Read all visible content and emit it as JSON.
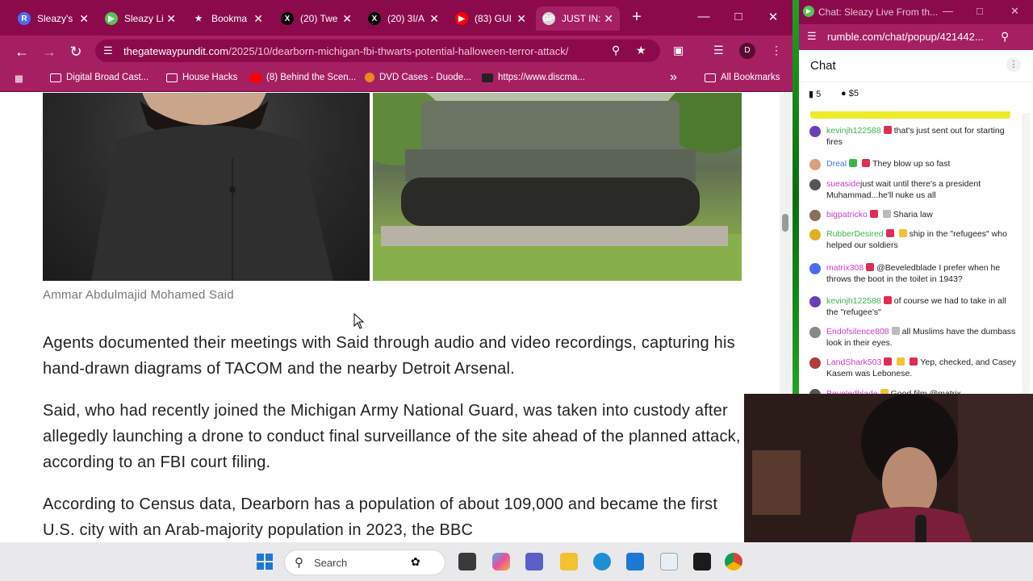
{
  "browser": {
    "tabs": [
      {
        "title": "Sleazy's",
        "icon_letter": "R",
        "icon_color": "#4a6cf7",
        "active": false
      },
      {
        "title": "Sleazy Li",
        "icon_letter": "▶",
        "icon_color": "#53c453",
        "active": false
      },
      {
        "title": "Bookma",
        "icon_letter": "★",
        "icon_color": "#8b0a4b",
        "active": false
      },
      {
        "title": "(20) Twe",
        "icon_letter": "X",
        "icon_color": "#000000",
        "active": false
      },
      {
        "title": "(20) 3I/A",
        "icon_letter": "X",
        "icon_color": "#000000",
        "active": false
      },
      {
        "title": "(83) GUI",
        "icon_letter": "▶",
        "icon_color": "#ff0000",
        "active": false
      },
      {
        "title": "JUST IN:",
        "icon_letter": "GP",
        "icon_color": "#d7d7d7",
        "active": true
      }
    ],
    "new_tab_label": "+",
    "url_domain": "thegatewaypundit.com",
    "url_path": "/2025/10/dearborn-michigan-fbi-thwarts-potential-halloween-terror-attack/",
    "profile_letter": "D",
    "bookmarks": [
      {
        "label": "Digital Broad Cast...",
        "icon": "folder-icon"
      },
      {
        "label": "House Hacks",
        "icon": "folder-icon"
      },
      {
        "label": "(8) Behind the Scen...",
        "icon": "youtube-icon"
      },
      {
        "label": "DVD Cases - Duode...",
        "icon": "dvd-icon"
      },
      {
        "label": "https://www.discma...",
        "icon": "discord-icon"
      }
    ],
    "all_bookmarks_label": "All Bookmarks",
    "overflow_label": "»"
  },
  "article": {
    "caption": "Ammar Abdulmajid Mohamed Said",
    "paragraphs": [
      "Agents documented their meetings with Said through audio and video recordings, capturing his hand-drawn diagrams of TACOM and the nearby Detroit Arsenal.",
      "Said, who had recently joined the Michigan Army National Guard, was taken into custody after allegedly launching a drone to conduct final surveillance of the site ahead of the planned attack, according to an FBI court filing.",
      "According to Census data, Dearborn has a population of about 109,000 and became the first U.S. city with an Arab-majority population in 2023, the BBC"
    ]
  },
  "taskbar": {
    "search_label": "Search"
  },
  "chat_window": {
    "title": "Chat: Sleazy Live From th...",
    "url": "rumble.com/chat/popup/421442...",
    "heading": "Chat",
    "rant_count": "5",
    "rant_amount": "$5",
    "messages": [
      {
        "user": "kevinjh122588",
        "user_color": "#3bb54a",
        "avatar_color": "#6a3fb5",
        "badges": [
          "red"
        ],
        "text": "that's just sent out for starting fires"
      },
      {
        "user": "Dreal",
        "user_color": "#3d7be6",
        "avatar_color": "#d9a07c",
        "badges": [
          "green",
          "red"
        ],
        "text": "They blow up so fast"
      },
      {
        "user": "sueaside",
        "user_color": "#c83cc8",
        "avatar_color": "#555555",
        "badges": [],
        "text": "just wait until there's a president Muhammad...he'll nuke us all"
      },
      {
        "user": "bigpatricko",
        "user_color": "#c83cc8",
        "avatar_color": "#8a6f5a",
        "badges": [
          "red",
          "grey"
        ],
        "text": "Sharia law"
      },
      {
        "user": "RubberDesired",
        "user_color": "#3bb54a",
        "avatar_color": "#e0b020",
        "badges": [
          "red",
          "yellow"
        ],
        "text": "ship in the \"refugees\" who helped our soldiers"
      },
      {
        "user": "matrix308",
        "user_color": "#c83cc8",
        "avatar_color": "#4a6cf7",
        "badges": [
          "red"
        ],
        "text": "@Beveledblade I prefer when he throws the boot in the toilet in 1943?"
      },
      {
        "user": "kevinjh122588",
        "user_color": "#3bb54a",
        "avatar_color": "#6a3fb5",
        "badges": [
          "red"
        ],
        "text": "of course we had to take in all the \"refugee's\""
      },
      {
        "user": "Endofsilence808",
        "user_color": "#c83cc8",
        "avatar_color": "#888888",
        "badges": [
          "grey"
        ],
        "text": "all Muslims have the dumbass look in their eyes."
      },
      {
        "user": "LandShark503",
        "user_color": "#c83cc8",
        "avatar_color": "#b33a3a",
        "badges": [
          "red",
          "yellow",
          "red"
        ],
        "text": "Yep, checked, and Casey Kasem was Lebonese."
      },
      {
        "user": "Beveledblade",
        "user_color": "#c83cc8",
        "avatar_color": "#555555",
        "badges": [
          "yellow"
        ],
        "text": "Good film @matrix"
      }
    ]
  }
}
